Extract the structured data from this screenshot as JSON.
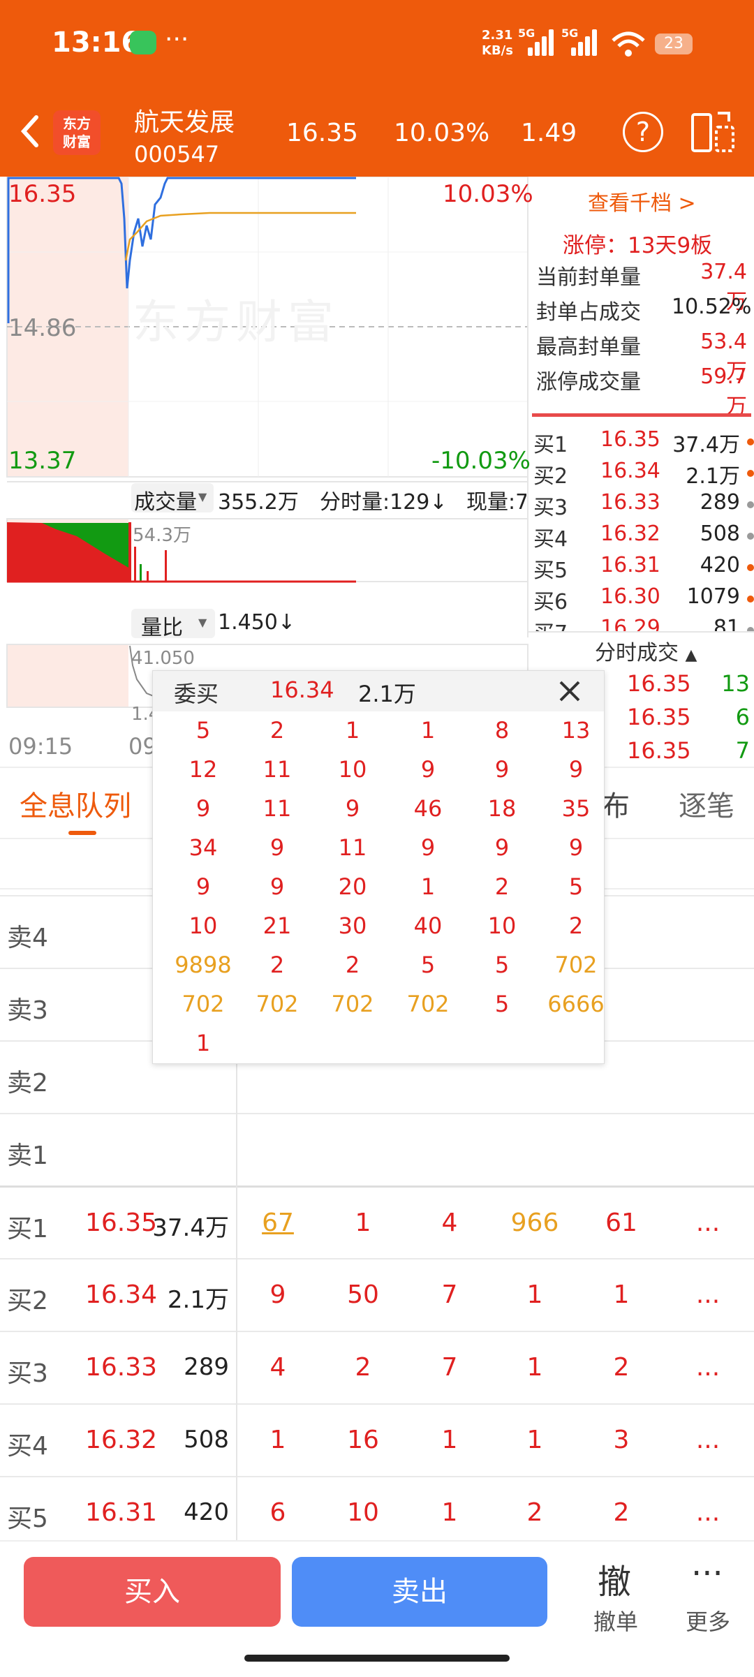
{
  "status": {
    "time": "13:16",
    "more": "···",
    "speed_value": "2.31",
    "speed_unit": "KB/s",
    "net1": "5G",
    "net2": "5G",
    "battery": "23"
  },
  "header": {
    "logo_line1": "东方",
    "logo_line2": "财富",
    "stock_name": "航天发展",
    "stock_code": "000547",
    "price": "16.35",
    "change_pct": "10.03%",
    "change_amt": "1.49",
    "help": "?"
  },
  "chart": {
    "watermark": "东方财富",
    "price_high": "16.35",
    "price_prev_close": "14.86",
    "price_low": "13.37",
    "pct_high": "10.03%",
    "pct_low": "-10.03%",
    "volume_selector": "成交量",
    "volume_total": "355.2万",
    "minute_volume": "分时量:129↓",
    "current_volume": "现量:7",
    "volume_axis_max": "54.3万",
    "ratio_selector": "量比",
    "ratio_value": "1.450↓",
    "ratio_axis_max": "41.050",
    "ratio_axis_partial": "1.4",
    "time_start": "09:15",
    "time_partial": "09"
  },
  "right_panel": {
    "view_levels": "查看千档 >",
    "limit_up": "涨停：13天9板",
    "stats": [
      {
        "label": "当前封单量",
        "value": "37.4万"
      },
      {
        "label": "封单占成交",
        "value": "10.52%"
      },
      {
        "label": "最高封单量",
        "value": "53.4万"
      },
      {
        "label": "涨停成交量",
        "value": "59.7万"
      }
    ],
    "book": [
      {
        "label": "买1",
        "price": "16.35",
        "volume": "37.4万",
        "dot": "#ee5a0c"
      },
      {
        "label": "买2",
        "price": "16.34",
        "volume": "2.1万",
        "dot": "#ee5a0c"
      },
      {
        "label": "买3",
        "price": "16.33",
        "volume": "289",
        "dot": "#9a9a9a"
      },
      {
        "label": "买4",
        "price": "16.32",
        "volume": "508",
        "dot": "#9a9a9a"
      },
      {
        "label": "买5",
        "price": "16.31",
        "volume": "420",
        "dot": "#ee5a0c"
      },
      {
        "label": "买6",
        "price": "16.30",
        "volume": "1079",
        "dot": "#ee5a0c"
      },
      {
        "label": "买7",
        "price": "16.29",
        "volume": "81",
        "dot": "#9a9a9a"
      }
    ],
    "ticks_title": "分时成交",
    "ticks": [
      {
        "price": "16.35",
        "volume": "13"
      },
      {
        "price": "16.35",
        "volume": "6"
      },
      {
        "price": "16.35",
        "volume": "7"
      }
    ]
  },
  "tabs": {
    "queue": "全息队列",
    "dist": "布",
    "tick": "逐笔"
  },
  "queue": {
    "sell": [
      {
        "label": "卖4"
      },
      {
        "label": "卖3"
      },
      {
        "label": "卖2"
      },
      {
        "label": "卖1"
      }
    ],
    "buy": [
      {
        "label": "买1",
        "price": "16.35",
        "volume": "37.4万",
        "orders": [
          "67",
          "1",
          "4",
          "966",
          "61",
          "..."
        ]
      },
      {
        "label": "买2",
        "price": "16.34",
        "volume": "2.1万",
        "orders": [
          "9",
          "50",
          "7",
          "1",
          "1",
          "..."
        ]
      },
      {
        "label": "买3",
        "price": "16.33",
        "volume": "289",
        "orders": [
          "4",
          "2",
          "7",
          "1",
          "2",
          "..."
        ]
      },
      {
        "label": "买4",
        "price": "16.32",
        "volume": "508",
        "orders": [
          "1",
          "16",
          "1",
          "1",
          "3",
          "..."
        ]
      },
      {
        "label": "买5",
        "price": "16.31",
        "volume": "420",
        "orders": [
          "6",
          "10",
          "1",
          "2",
          "2",
          "..."
        ]
      }
    ]
  },
  "popup": {
    "title": "委买",
    "price": "16.34",
    "volume": "2.1万",
    "rows": [
      [
        "5",
        "2",
        "1",
        "1",
        "8",
        "13"
      ],
      [
        "12",
        "11",
        "10",
        "9",
        "9",
        "9"
      ],
      [
        "9",
        "11",
        "9",
        "46",
        "18",
        "35"
      ],
      [
        "34",
        "9",
        "11",
        "9",
        "9",
        "9"
      ],
      [
        "9",
        "9",
        "20",
        "1",
        "2",
        "5"
      ],
      [
        "10",
        "21",
        "30",
        "40",
        "10",
        "2"
      ],
      [
        "9898",
        "2",
        "2",
        "5",
        "5",
        "702"
      ],
      [
        "702",
        "702",
        "702",
        "702",
        "5",
        "6666"
      ],
      [
        "1"
      ]
    ],
    "highlight_values": [
      "9898",
      "702",
      "6666"
    ]
  },
  "bottom": {
    "buy": "买入",
    "sell": "卖出",
    "cancel_icon": "撤",
    "cancel": "撤单",
    "more_icon": "···",
    "more": "更多"
  },
  "colors": {
    "brand": "#ee5a0c",
    "up": "#e02020",
    "down": "#129a12",
    "highlight": "#e8a020",
    "buy": "#ef5a5a",
    "sell": "#4f8df7"
  }
}
